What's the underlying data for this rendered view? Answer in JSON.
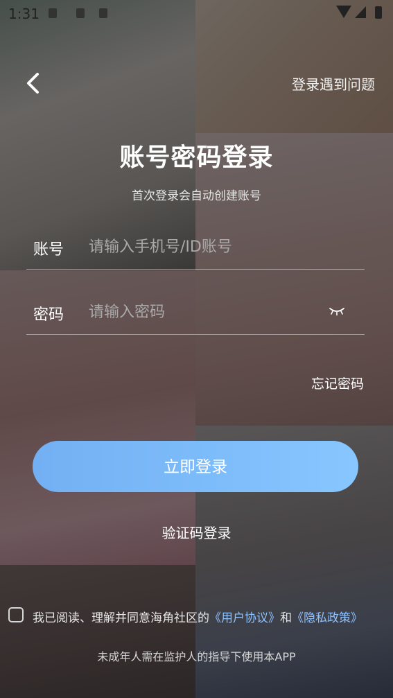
{
  "status_bar": {
    "time": "1:31",
    "icons": [
      "sim-icon",
      "square-icon",
      "wifi-icon",
      "signal-icon",
      "battery-icon"
    ]
  },
  "header": {
    "back_icon": "chevron-left-icon",
    "help_link": "登录遇到问题"
  },
  "page": {
    "title": "账号密码登录",
    "subtitle": "首次登录会自动创建账号"
  },
  "form": {
    "account": {
      "label": "账号",
      "placeholder": "请输入手机号/ID账号",
      "value": ""
    },
    "password": {
      "label": "密码",
      "placeholder": "请输入密码",
      "value": "",
      "toggle_icon": "eye-closed-icon"
    },
    "forgot_link": "忘记密码",
    "submit_label": "立即登录",
    "alt_login": "验证码登录"
  },
  "agreement": {
    "checked": false,
    "prefix": "我已阅读、理解并同意海角社区的",
    "user_agreement": "《用户协议》",
    "conjunction": "和",
    "privacy_policy": "《隐私政策》"
  },
  "minor_note": "未成年人需在监护人的指导下使用本APP",
  "colors": {
    "accent": "#7dbcfa",
    "link": "#8ec1ff",
    "text": "#ffffff"
  }
}
